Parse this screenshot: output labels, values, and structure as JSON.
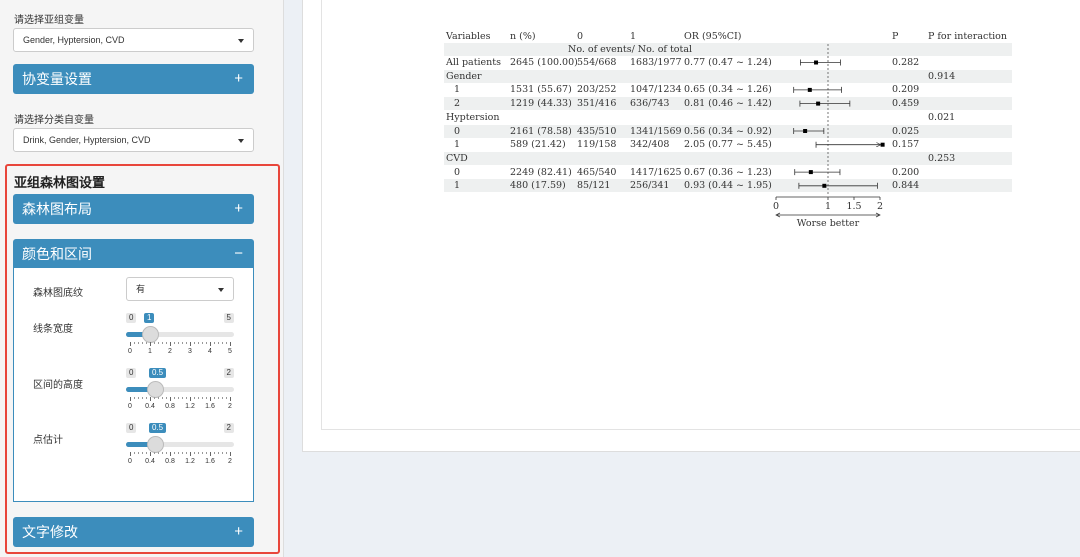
{
  "sidebar": {
    "subgroup_var_label": "请选择亚组变量",
    "subgroup_var_value": "Gender, Hyptersion, CVD",
    "covariate_panel": "协变量设置",
    "categorical_var_label": "请选择分类自变量",
    "categorical_var_value": "Drink, Gender, Hyptersion, CVD",
    "forest_section_title": "亚组森林图设置",
    "layout_panel": "森林图布局",
    "color_panel": "颜色和区间",
    "text_panel": "文字修改",
    "expand_symbol": "+",
    "collapse_symbol": "−"
  },
  "controls": {
    "background": {
      "label": "森林图底纹",
      "value": "有"
    },
    "line_width": {
      "label": "线条宽度",
      "min_label": "0",
      "max_label": "5",
      "value_label": "1",
      "min": 0,
      "max": 5,
      "value": 1,
      "ticks": [
        "0",
        "1",
        "2",
        "3",
        "4",
        "5"
      ]
    },
    "ci_height": {
      "label": "区间的高度",
      "min_label": "0",
      "max_label": "2",
      "value_label": "0.5",
      "min": 0,
      "max": 2,
      "value": 0.5,
      "ticks": [
        "0",
        "0.4",
        "0.8",
        "1.2",
        "1.6",
        "2"
      ]
    },
    "point_size": {
      "label": "点估计",
      "min_label": "0",
      "max_label": "2",
      "value_label": "0.5",
      "min": 0,
      "max": 2,
      "value": 0.5,
      "ticks": [
        "0",
        "0.4",
        "0.8",
        "1.2",
        "1.6",
        "2"
      ]
    }
  },
  "forest": {
    "headers": {
      "variables": "Variables",
      "n": "n (%)",
      "c0": "0",
      "c1": "1",
      "or": "OR (95%CI)",
      "p": "P",
      "pint": "P for interaction"
    },
    "subheader": "No. of events/ No. of total",
    "rows": [
      {
        "variable": "All patients",
        "indent": false,
        "n": "2645 (100.00)",
        "e0": "554/668",
        "e1": "1683/1977",
        "or_text": "0.77 (0.47 ~ 1.24)",
        "p": "0.282",
        "pint": "",
        "or": 0.77,
        "lo": 0.47,
        "hi": 1.24,
        "arrow": false
      },
      {
        "variable": "Gender",
        "indent": false,
        "n": "",
        "e0": "",
        "e1": "",
        "or_text": "",
        "p": "",
        "pint": "0.914",
        "or": null
      },
      {
        "variable": "1",
        "indent": true,
        "n": "1531 (55.67)",
        "e0": "203/252",
        "e1": "1047/1234",
        "or_text": "0.65 (0.34 ~ 1.26)",
        "p": "0.209",
        "pint": "",
        "or": 0.65,
        "lo": 0.34,
        "hi": 1.26,
        "arrow": false
      },
      {
        "variable": "2",
        "indent": true,
        "n": "1219 (44.33)",
        "e0": "351/416",
        "e1": "636/743",
        "or_text": "0.81 (0.46 ~ 1.42)",
        "p": "0.459",
        "pint": "",
        "or": 0.81,
        "lo": 0.46,
        "hi": 1.42,
        "arrow": false
      },
      {
        "variable": "Hyptersion",
        "indent": false,
        "n": "",
        "e0": "",
        "e1": "",
        "or_text": "",
        "p": "",
        "pint": "0.021",
        "or": null
      },
      {
        "variable": "0",
        "indent": true,
        "n": "2161 (78.58)",
        "e0": "435/510",
        "e1": "1341/1569",
        "or_text": "0.56 (0.34 ~ 0.92)",
        "p": "0.025",
        "pint": "",
        "or": 0.56,
        "lo": 0.34,
        "hi": 0.92,
        "arrow": false
      },
      {
        "variable": "1",
        "indent": true,
        "n": "589 (21.42)",
        "e0": "119/158",
        "e1": "342/408",
        "or_text": "2.05 (0.77 ~ 5.45)",
        "p": "0.157",
        "pint": "",
        "or": 2.05,
        "lo": 0.77,
        "hi": 5.45,
        "arrow": true
      },
      {
        "variable": "CVD",
        "indent": false,
        "n": "",
        "e0": "",
        "e1": "",
        "or_text": "",
        "p": "",
        "pint": "0.253",
        "or": null
      },
      {
        "variable": "0",
        "indent": true,
        "n": "2249 (82.41)",
        "e0": "465/540",
        "e1": "1417/1625",
        "or_text": "0.67 (0.36 ~ 1.23)",
        "p": "0.200",
        "pint": "",
        "or": 0.67,
        "lo": 0.36,
        "hi": 1.23,
        "arrow": false
      },
      {
        "variable": "1",
        "indent": true,
        "n": "480 (17.59)",
        "e0": "85/121",
        "e1": "256/341",
        "or_text": "0.93 (0.44 ~ 1.95)",
        "p": "0.844",
        "pint": "",
        "or": 0.93,
        "lo": 0.44,
        "hi": 1.95,
        "arrow": false
      }
    ],
    "axis_ticks": [
      "0",
      "1",
      "1.5",
      "2"
    ],
    "axis_min": 0,
    "axis_max": 2,
    "ref_line": 1,
    "direction_label": "Worse  better"
  }
}
